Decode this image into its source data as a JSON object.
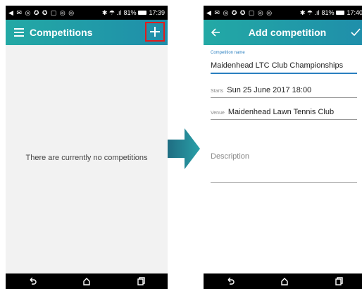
{
  "status_left": {
    "icons": "◀ ✉ ◎ ✪ ✪ ▢ ◎ ◎",
    "bt_signal": "✱ ☂ .ıl",
    "battery_pct": "81%",
    "time": "17:39"
  },
  "status_right": {
    "icons": "◀ ✉ ◎ ✪ ✪ ▢ ◎ ◎",
    "bt_signal": "✱ ☂ .ıl",
    "battery_pct": "81%",
    "time": "17:40"
  },
  "left_screen": {
    "title": "Competitions",
    "empty_message": "There are currently no competitions",
    "add_button_highlight_color": "#e21b1b"
  },
  "right_screen": {
    "title": "Add competition",
    "name_label": "Competition name",
    "name_value": "Maidenhead LTC Club Championships",
    "starts_label": "Starts",
    "starts_value": "Sun 25 June 2017 18:00",
    "venue_label": "Venue",
    "venue_value": "Maidenhead Lawn Tennis Club",
    "description_placeholder": "Description"
  },
  "colors": {
    "appbar_start": "#23a9a5",
    "appbar_end": "#1f8eaa",
    "arrow": "#2a8a9a",
    "accent": "#2a7fc0"
  },
  "icons": [
    "menu-icon",
    "plus-icon",
    "back-arrow-icon",
    "check-icon",
    "nav-back-icon",
    "nav-home-icon",
    "nav-recents-icon",
    "transition-arrow-icon"
  ]
}
